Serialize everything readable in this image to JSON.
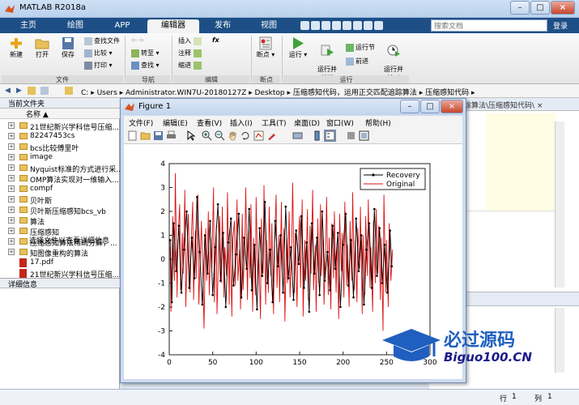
{
  "app": {
    "title": "MATLAB R2018a"
  },
  "tabs": [
    {
      "label": "主页"
    },
    {
      "label": "绘图"
    },
    {
      "label": "APP"
    },
    {
      "label": "编辑器"
    },
    {
      "label": "发布"
    },
    {
      "label": "视图"
    }
  ],
  "search": {
    "placeholder": "搜索文档"
  },
  "login": "登录",
  "ribbon": {
    "file": {
      "new": "新建",
      "open": "打开",
      "save": "保存",
      "find_files": "查找文件",
      "compare": "比较",
      "print": "打印",
      "group": "文件"
    },
    "nav": {
      "goto": "转至",
      "find": "查找",
      "group": "导航"
    },
    "edit": {
      "insert": "插入",
      "comment": "注释",
      "indent": "缩进",
      "fx": "fx",
      "group": "编辑"
    },
    "breakpoints": {
      "label": "断点",
      "group": "断点"
    },
    "run": {
      "run": "运行",
      "run_advance": "运行并\n前进",
      "run_section": "运行节",
      "advance": "前进",
      "run_time": "运行并\n计时",
      "group": "运行"
    }
  },
  "address": {
    "segments": [
      "C:",
      "Users",
      "Administrator.WIN7U-20180127Z",
      "Desktop",
      "压缩感知代码，运用正交匹配追踪算法",
      "压缩感知代码"
    ]
  },
  "left_panel": {
    "header": "当前文件夹",
    "col_name": "名称",
    "files": [
      {
        "name": "21世纪新兴学科信号压缩...",
        "type": "folder"
      },
      {
        "name": "82247453cs",
        "type": "folder"
      },
      {
        "name": "bcs比较傅里叶",
        "type": "folder"
      },
      {
        "name": "image",
        "type": "folder"
      },
      {
        "name": "Nyquist标准的方式进行采...",
        "type": "folder"
      },
      {
        "name": "OMP算法实现对一维输入...",
        "type": "folder"
      },
      {
        "name": "compf",
        "type": "folder"
      },
      {
        "name": "贝叶斯",
        "type": "folder"
      },
      {
        "name": "贝叶斯压缩感知bcs_vb",
        "type": "folder"
      },
      {
        "name": "算法",
        "type": "folder"
      },
      {
        "name": "压缩感知",
        "type": "folder"
      },
      {
        "name": "压缩感知算法稀疏分解，...",
        "type": "folder"
      },
      {
        "name": "知图像重构的算法",
        "type": "folder"
      },
      {
        "name": "17.pdf",
        "type": "pdf"
      },
      {
        "name": "21世纪新兴学科信号压缩...",
        "type": "pdf"
      }
    ],
    "detail_header": "详细信息",
    "detail_text": "选择文件以查看详细信息"
  },
  "editor": {
    "strip_text": "除算法\\压缩感知代码\\ ×"
  },
  "figure": {
    "title": "Figure 1",
    "menus": [
      "文件(F)",
      "编辑(E)",
      "查看(V)",
      "插入(I)",
      "工具(T)",
      "桌面(D)",
      "窗口(W)",
      "帮助(H)"
    ]
  },
  "status": {
    "row_label": "行",
    "row": "1",
    "col_label": "列",
    "col": "1"
  },
  "watermark": {
    "brand": "必过源码",
    "url": "Biguo100.CN"
  },
  "colors": {
    "recovery": "#000000",
    "original": "#dd1111",
    "tabbar": "#1d4f86"
  },
  "chart_data": {
    "type": "line",
    "title": "",
    "xlabel": "",
    "ylabel": "",
    "xlim": [
      0,
      300
    ],
    "ylim": [
      -4,
      4
    ],
    "xticks": [
      0,
      50,
      100,
      150,
      200,
      250,
      300
    ],
    "yticks": [
      -4,
      -3,
      -2,
      -1,
      0,
      1,
      2,
      3,
      4
    ],
    "legend": {
      "position": "top-right",
      "entries": [
        "Recovery",
        "Original"
      ]
    },
    "series": [
      {
        "name": "Recovery",
        "color": "#000000",
        "marker": "dot",
        "x": [
          1,
          3,
          5,
          8,
          11,
          14,
          17,
          20,
          23,
          26,
          29,
          32,
          35,
          38,
          41,
          44,
          47,
          50,
          53,
          56,
          59,
          62,
          65,
          68,
          71,
          74,
          77,
          80,
          83,
          86,
          89,
          92,
          95,
          98,
          101,
          104,
          107,
          110,
          113,
          116,
          119,
          122,
          125,
          128,
          131,
          134,
          137,
          140,
          143,
          146,
          149,
          152,
          155,
          158,
          161,
          164,
          167,
          170,
          173,
          176,
          179,
          182,
          185,
          188,
          191,
          194,
          197,
          200,
          203,
          206,
          209,
          212,
          215,
          218,
          221,
          224,
          227,
          230,
          233,
          236,
          239,
          242,
          245,
          248,
          251,
          254,
          256
        ],
        "y": [
          0.8,
          -1.8,
          1.5,
          -0.5,
          1.4,
          -1.4,
          0.4,
          2.0,
          -1.2,
          0.9,
          -0.8,
          2.6,
          0.3,
          -1.9,
          1.0,
          -0.6,
          1.6,
          -1.5,
          0.5,
          2.3,
          -0.9,
          1.1,
          -2.0,
          0.7,
          1.7,
          -1.1,
          0.2,
          1.9,
          -1.6,
          0.9,
          -0.4,
          2.1,
          -1.3,
          0.6,
          -2.1,
          1.3,
          -0.7,
          2.4,
          -1.0,
          0.4,
          -1.8,
          1.6,
          -0.3,
          1.0,
          -1.4,
          2.2,
          -0.8,
          0.5,
          -1.7,
          1.2,
          -0.2,
          1.8,
          -1.2,
          0.7,
          -2.2,
          1.5,
          -0.6,
          0.9,
          -1.5,
          2.0,
          -0.9,
          0.3,
          -1.3,
          1.4,
          -0.4,
          1.1,
          -2.0,
          0.6,
          1.9,
          -1.1,
          0.8,
          -1.6,
          1.7,
          -0.5,
          1.0,
          -1.9,
          0.4,
          1.5,
          -1.2,
          2.1,
          -0.7,
          1.3,
          -1.0,
          0.6,
          -1.4,
          1.2,
          -0.3
        ]
      },
      {
        "name": "Original",
        "color": "#dd1111",
        "marker": "none",
        "x": [
          1,
          2,
          4,
          6,
          7,
          9,
          10,
          12,
          13,
          15,
          16,
          18,
          19,
          21,
          22,
          24,
          25,
          27,
          28,
          30,
          31,
          33,
          34,
          36,
          37,
          39,
          40,
          42,
          43,
          45,
          46,
          48,
          49,
          51,
          52,
          54,
          55,
          57,
          58,
          60,
          61,
          63,
          64,
          66,
          67,
          69,
          70,
          72,
          73,
          75,
          76,
          78,
          79,
          81,
          82,
          84,
          85,
          87,
          88,
          90,
          91,
          93,
          94,
          96,
          97,
          99,
          100,
          102,
          103,
          105,
          106,
          108,
          109,
          111,
          112,
          114,
          115,
          117,
          118,
          120,
          121,
          123,
          124,
          126,
          127,
          129,
          130,
          132,
          133,
          135,
          136,
          138,
          139,
          141,
          142,
          144,
          145,
          147,
          148,
          150,
          151,
          153,
          154,
          156,
          157,
          159,
          160,
          162,
          163,
          165,
          166,
          168,
          169,
          171,
          172,
          174,
          175,
          177,
          178,
          180,
          181,
          183,
          184,
          186,
          187,
          189,
          190,
          192,
          193,
          195,
          196,
          198,
          199,
          201,
          202,
          204,
          205,
          207,
          208,
          210,
          211,
          213,
          214,
          216,
          217,
          219,
          220,
          222,
          223,
          225,
          226,
          228,
          229,
          231,
          232,
          234,
          235,
          237,
          238,
          240,
          241,
          243,
          244,
          246,
          247,
          249,
          250,
          252,
          253,
          255,
          257
        ],
        "y": [
          0.5,
          -2.2,
          1.8,
          -0.9,
          3.6,
          -1.6,
          0.7,
          2.3,
          -1.3,
          1.1,
          -0.6,
          2.9,
          -2.0,
          0.8,
          1.9,
          -1.4,
          0.5,
          2.4,
          -1.7,
          1.2,
          -0.8,
          2.7,
          -1.9,
          0.3,
          1.6,
          -1.2,
          -2.9,
          1.3,
          -0.9,
          2.0,
          -1.5,
          0.9,
          -0.4,
          3.0,
          -1.8,
          1.4,
          -2.3,
          0.6,
          1.8,
          -1.0,
          2.2,
          -1.6,
          0.5,
          -0.7,
          2.8,
          -1.9,
          1.3,
          -2.4,
          0.8,
          1.6,
          -1.1,
          2.5,
          -0.9,
          0.4,
          -2.1,
          1.9,
          -1.3,
          0.7,
          3.0,
          -1.7,
          1.2,
          -0.8,
          2.3,
          -2.2,
          0.9,
          -1.5,
          2.6,
          -1.1,
          0.3,
          -2.5,
          1.7,
          -0.6,
          3.1,
          -1.9,
          0.8,
          -1.4,
          2.2,
          -0.7,
          1.5,
          -2.3,
          0.6,
          2.7,
          -1.2,
          1.0,
          -1.8,
          2.4,
          -0.5,
          1.3,
          -2.6,
          0.9,
          -1.0,
          2.0,
          -1.6,
          0.7,
          3.2,
          -1.4,
          1.1,
          -2.0,
          0.5,
          1.8,
          -1.2,
          2.5,
          -2.4,
          0.8,
          -0.9,
          2.1,
          -1.7,
          1.4,
          -0.6,
          2.9,
          -1.3,
          0.6,
          -2.2,
          1.7,
          -1.0,
          2.3,
          -0.7,
          1.2,
          -1.9,
          0.4,
          2.6,
          -1.5,
          0.9,
          -2.1,
          1.5,
          -0.8,
          2.0,
          -1.4,
          0.7,
          -2.5,
          1.9,
          -0.5,
          1.1,
          -1.6,
          2.4,
          -1.1,
          0.6,
          -2.0,
          1.6,
          -0.9,
          2.8,
          -1.3,
          0.8,
          -1.8,
          1.3,
          -0.4,
          2.2,
          -2.3,
          1.0,
          -1.5,
          1.8,
          -0.7,
          2.5,
          -1.2,
          0.5,
          -2.2,
          1.6,
          -1.0,
          2.1,
          -0.6,
          1.4,
          -1.7,
          0.9,
          -3.0,
          2.7,
          -1.4,
          0.8,
          -2.0,
          1.5,
          -0.9,
          0.4
        ]
      }
    ]
  }
}
